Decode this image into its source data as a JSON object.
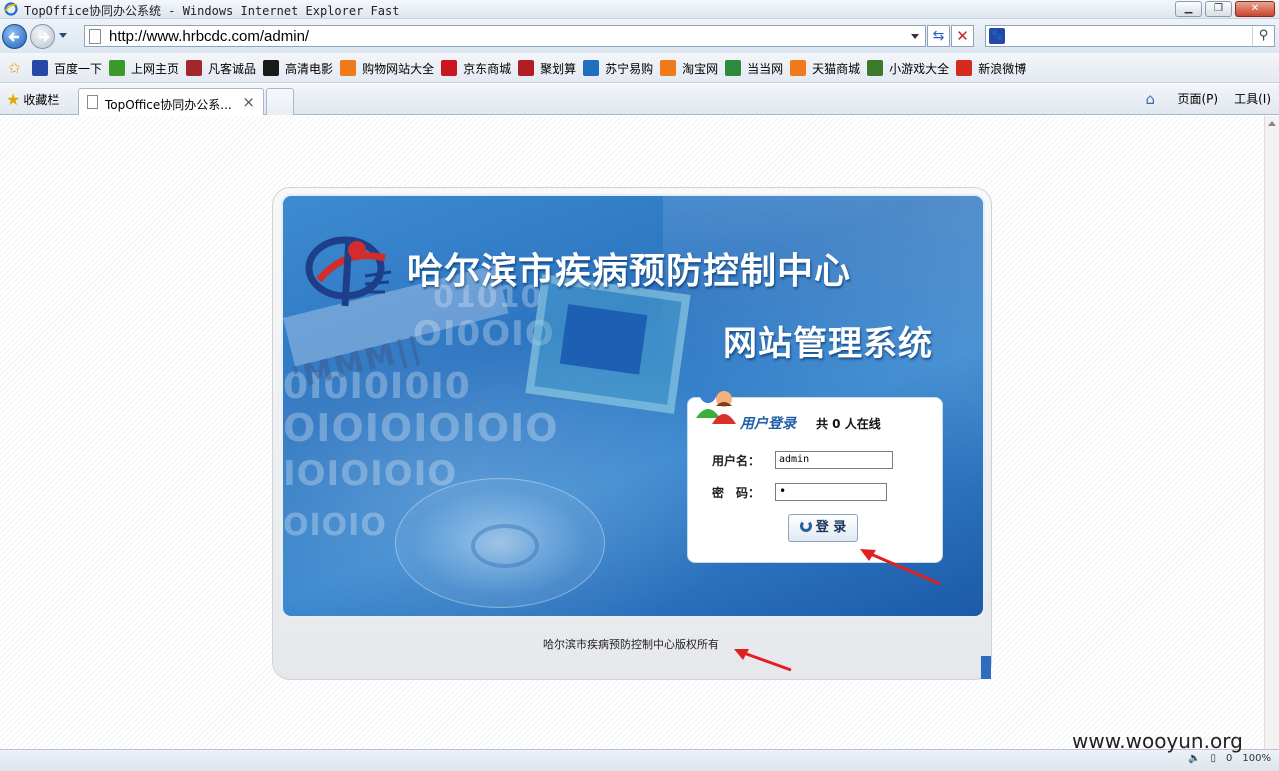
{
  "window": {
    "title": "TopOffice协同办公系统 - Windows Internet Explorer Fast"
  },
  "address": {
    "url": "http://www.hrbcdc.com/admin/"
  },
  "search": {
    "value": ""
  },
  "favorites_links": [
    {
      "label": "百度一下",
      "icon": "baidu-icon",
      "color": "#2447a8"
    },
    {
      "label": "上网主页",
      "icon": "hao-icon",
      "color": "#3a9a2a"
    },
    {
      "label": "凡客诚品",
      "icon": "vancl-icon",
      "color": "#a3262a"
    },
    {
      "label": "高清电影",
      "icon": "movie-icon",
      "color": "#1a1a1a"
    },
    {
      "label": "购物网站大全",
      "icon": "taobao-icon",
      "color": "#f07a1a"
    },
    {
      "label": "京东商城",
      "icon": "jd-icon",
      "color": "#c81623"
    },
    {
      "label": "聚划算",
      "icon": "juhuasuan-icon",
      "color": "#b01e24"
    },
    {
      "label": "苏宁易购",
      "icon": "suning-icon",
      "color": "#1f6fc0"
    },
    {
      "label": "淘宝网",
      "icon": "taobao-icon",
      "color": "#f07a1a"
    },
    {
      "label": "当当网",
      "icon": "dangdang-icon",
      "color": "#2e8a3c"
    },
    {
      "label": "天猫商城",
      "icon": "tmall-icon",
      "color": "#f07a1a"
    },
    {
      "label": "小游戏大全",
      "icon": "game-icon",
      "color": "#3a7a2a"
    },
    {
      "label": "新浪微博",
      "icon": "weibo-icon",
      "color": "#d52b1e"
    }
  ],
  "tabbar": {
    "favorites_label": "收藏栏",
    "tab_title": "TopOffice协同办公系...",
    "page_menu": "页面(P)",
    "tools_menu": "工具(I)"
  },
  "banner": {
    "title_line1": "哈尔滨市疾病预防控制中心",
    "title_line2": "网站管理系统"
  },
  "login": {
    "heading": "用户登录",
    "online_text": "共 0 人在线",
    "username_label": "用户名：",
    "username_value": "admin",
    "password_label": "密　码：",
    "password_value": "•",
    "submit_label": "登 录"
  },
  "footer": {
    "copyright": "哈尔滨市疾病预防控制中心版权所有"
  },
  "statusbar": {
    "count": "0",
    "zoom": "100%"
  },
  "watermark": "www.wooyun.org",
  "colors": {
    "banner_blue": "#2c74c0",
    "heading_blue": "#1f5fa8",
    "annotation_red": "#e02020"
  }
}
